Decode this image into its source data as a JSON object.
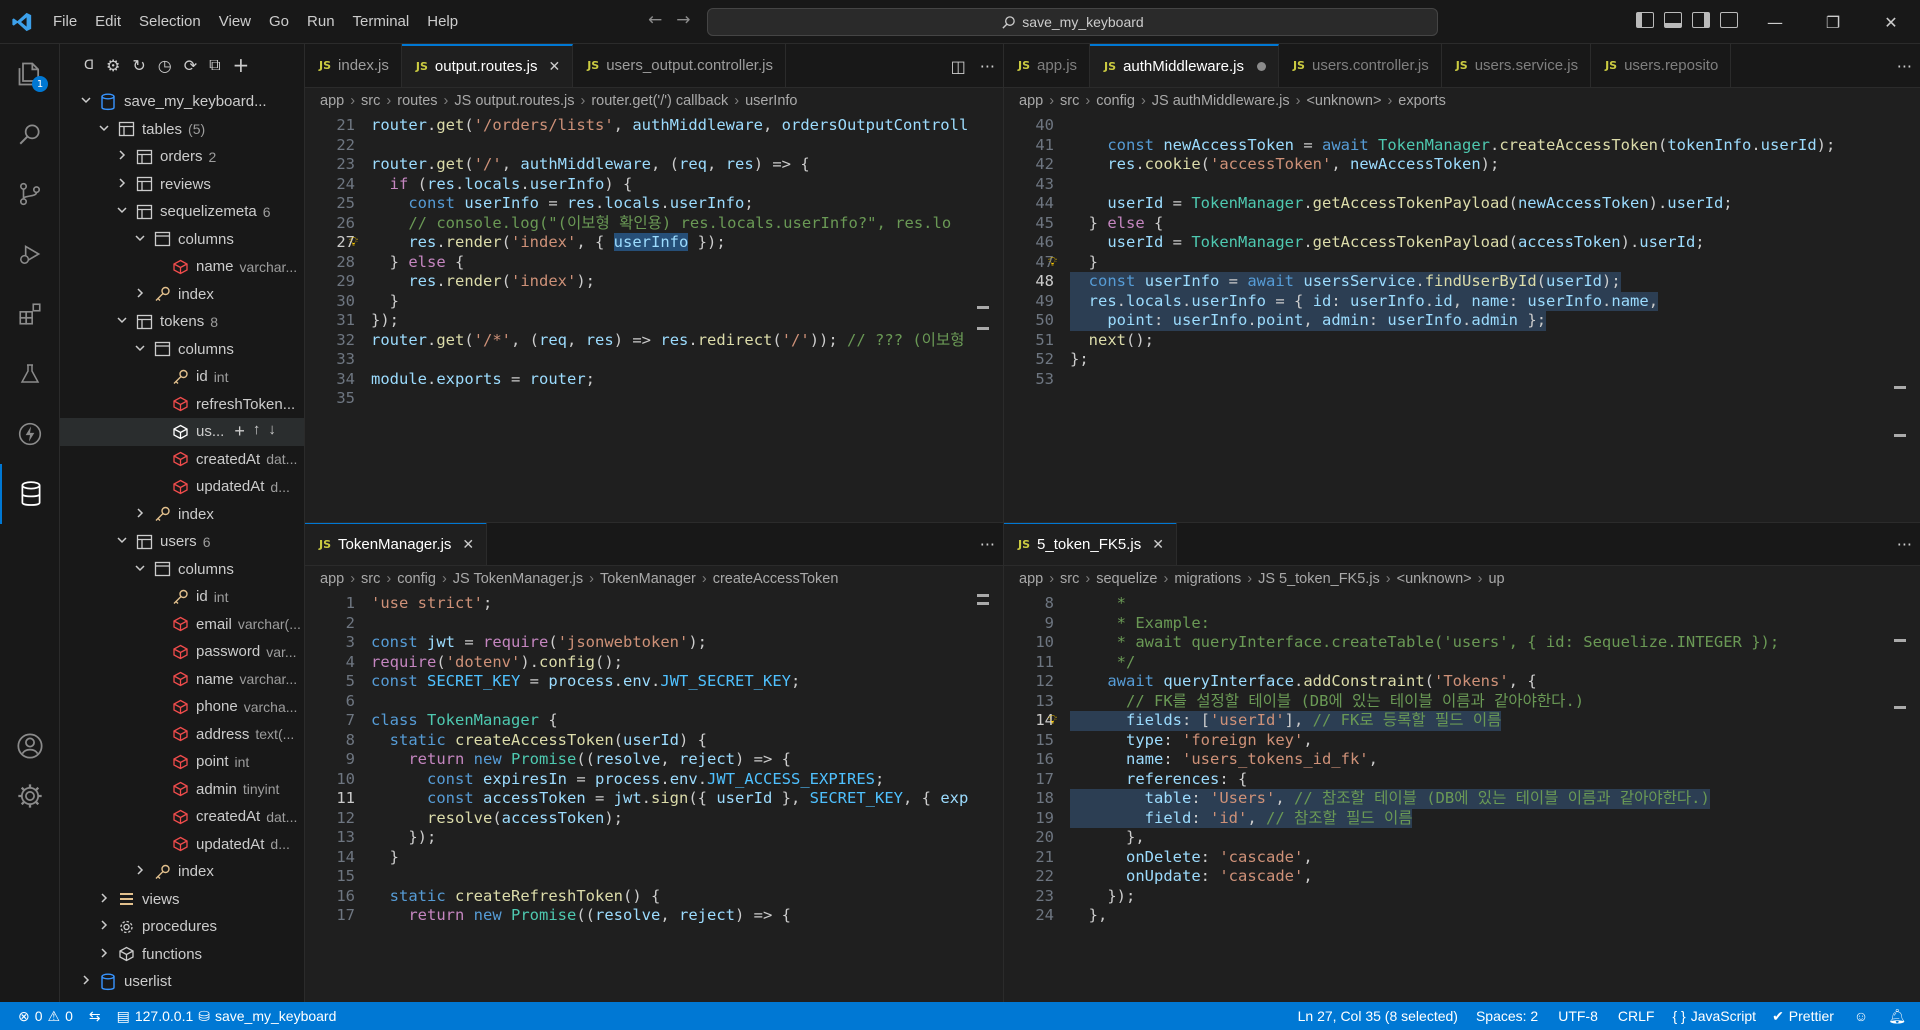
{
  "menu": [
    "File",
    "Edit",
    "Selection",
    "View",
    "Go",
    "Run",
    "Terminal",
    "Help"
  ],
  "search": {
    "text": "save_my_keyboard"
  },
  "activity": {
    "badge": "1"
  },
  "tree": [
    {
      "d": 0,
      "tw": "v",
      "icon": "db",
      "label": "save_my_keyboard...",
      "sub": ""
    },
    {
      "d": 1,
      "tw": "v",
      "icon": "table",
      "label": "tables",
      "sub": "(5)"
    },
    {
      "d": 2,
      "tw": ">",
      "icon": "table",
      "label": "orders",
      "sub": "2"
    },
    {
      "d": 2,
      "tw": ">",
      "icon": "table",
      "label": "reviews",
      "sub": ""
    },
    {
      "d": 2,
      "tw": "v",
      "icon": "table",
      "label": "sequelizemeta",
      "sub": "6"
    },
    {
      "d": 3,
      "tw": "v",
      "icon": "columns",
      "label": "columns",
      "sub": ""
    },
    {
      "d": 4,
      "tw": "",
      "icon": "col",
      "label": "name",
      "sub": "varchar..."
    },
    {
      "d": 3,
      "tw": ">",
      "icon": "key",
      "label": "index",
      "sub": ""
    },
    {
      "d": 2,
      "tw": "v",
      "icon": "table",
      "label": "tokens",
      "sub": "8"
    },
    {
      "d": 3,
      "tw": "v",
      "icon": "columns",
      "label": "columns",
      "sub": ""
    },
    {
      "d": 4,
      "tw": "",
      "icon": "key",
      "label": "id",
      "sub": "int"
    },
    {
      "d": 4,
      "tw": "",
      "icon": "col",
      "label": "refreshToken...",
      "sub": ""
    },
    {
      "d": 4,
      "tw": "",
      "icon": "cube",
      "label": "us...",
      "sub": "",
      "selected": true
    },
    {
      "d": 4,
      "tw": "",
      "icon": "col",
      "label": "createdAt",
      "sub": "dat..."
    },
    {
      "d": 4,
      "tw": "",
      "icon": "col",
      "label": "updatedAt",
      "sub": "d..."
    },
    {
      "d": 3,
      "tw": ">",
      "icon": "key",
      "label": "index",
      "sub": ""
    },
    {
      "d": 2,
      "tw": "v",
      "icon": "table",
      "label": "users",
      "sub": "6"
    },
    {
      "d": 3,
      "tw": "v",
      "icon": "columns",
      "label": "columns",
      "sub": ""
    },
    {
      "d": 4,
      "tw": "",
      "icon": "key",
      "label": "id",
      "sub": "int"
    },
    {
      "d": 4,
      "tw": "",
      "icon": "col",
      "label": "email",
      "sub": "varchar(..."
    },
    {
      "d": 4,
      "tw": "",
      "icon": "col",
      "label": "password",
      "sub": "var..."
    },
    {
      "d": 4,
      "tw": "",
      "icon": "col",
      "label": "name",
      "sub": "varchar..."
    },
    {
      "d": 4,
      "tw": "",
      "icon": "col",
      "label": "phone",
      "sub": "varcha..."
    },
    {
      "d": 4,
      "tw": "",
      "icon": "col",
      "label": "address",
      "sub": "text(..."
    },
    {
      "d": 4,
      "tw": "",
      "icon": "col",
      "label": "point",
      "sub": "int"
    },
    {
      "d": 4,
      "tw": "",
      "icon": "col",
      "label": "admin",
      "sub": "tinyint"
    },
    {
      "d": 4,
      "tw": "",
      "icon": "col",
      "label": "createdAt",
      "sub": "dat..."
    },
    {
      "d": 4,
      "tw": "",
      "icon": "col",
      "label": "updatedAt",
      "sub": "d..."
    },
    {
      "d": 3,
      "tw": ">",
      "icon": "key",
      "label": "index",
      "sub": ""
    },
    {
      "d": 1,
      "tw": ">",
      "icon": "views",
      "label": "views",
      "sub": ""
    },
    {
      "d": 1,
      "tw": ">",
      "icon": "gear",
      "label": "procedures",
      "sub": ""
    },
    {
      "d": 1,
      "tw": ">",
      "icon": "fn",
      "label": "functions",
      "sub": ""
    },
    {
      "d": 0,
      "tw": ">",
      "icon": "db",
      "label": "userlist",
      "sub": ""
    }
  ],
  "groups": [
    {
      "tabs": [
        {
          "label": "index.js",
          "active": false,
          "close": false,
          "dim": false,
          "dirty": false
        },
        {
          "label": "output.routes.js",
          "active": true,
          "close": true,
          "dim": false,
          "dirty": false
        },
        {
          "label": "users_output.controller.js",
          "active": false,
          "close": false,
          "dim": false,
          "dirty": false
        }
      ],
      "crumbs": [
        "app",
        "src",
        "routes",
        "JS output.routes.js",
        "router.get('/') callback",
        "userInfo"
      ],
      "lines": [
        {
          "n": "21",
          "t": "router.get('/orders/lists', authMiddleware, ordersOutputControll"
        },
        {
          "n": "22",
          "t": ""
        },
        {
          "n": "23",
          "t": "router.get('/', authMiddleware, (req, res) => {"
        },
        {
          "n": "24",
          "t": "  if (res.locals.userInfo) {"
        },
        {
          "n": "25",
          "t": "    const userInfo = res.locals.userInfo;"
        },
        {
          "n": "26",
          "t": "    // console.log(\"(이보형 확인용) res.locals.userInfo?\", res.lo"
        },
        {
          "n": "27",
          "t": "    res.render('index', { userInfo });",
          "bulb": true,
          "cur": true
        },
        {
          "n": "28",
          "t": "  } else {"
        },
        {
          "n": "29",
          "t": "    res.render('index');"
        },
        {
          "n": "30",
          "t": "  }"
        },
        {
          "n": "31",
          "t": "});"
        },
        {
          "n": "32",
          "t": "router.get('/*', (req, res) => res.redirect('/')); // ??? (이보형"
        },
        {
          "n": "33",
          "t": ""
        },
        {
          "n": "34",
          "t": "module.exports = router;"
        },
        {
          "n": "35",
          "t": ""
        }
      ]
    },
    {
      "tabs": [
        {
          "label": "app.js",
          "active": false,
          "close": false,
          "dim": true,
          "dirty": false
        },
        {
          "label": "authMiddleware.js",
          "active": true,
          "close": false,
          "dim": false,
          "dirty": true
        },
        {
          "label": "users.controller.js",
          "active": false,
          "close": false,
          "dim": true,
          "dirty": false
        },
        {
          "label": "users.service.js",
          "active": false,
          "close": false,
          "dim": true,
          "dirty": false
        },
        {
          "label": "users.reposito",
          "active": false,
          "close": false,
          "dim": true,
          "dirty": false
        }
      ],
      "crumbs": [
        "app",
        "src",
        "config",
        "JS authMiddleware.js",
        "<unknown>",
        "exports"
      ],
      "lines": [
        {
          "n": "40",
          "t": ""
        },
        {
          "n": "41",
          "t": "    const newAccessToken = await TokenManager.createAccessToken(tokenInfo.userId);"
        },
        {
          "n": "42",
          "t": "    res.cookie('accessToken', newAccessToken);"
        },
        {
          "n": "43",
          "t": ""
        },
        {
          "n": "44",
          "t": "    userId = TokenManager.getAccessTokenPayload(newAccessToken).userId;"
        },
        {
          "n": "45",
          "t": "  } else {"
        },
        {
          "n": "46",
          "t": "    userId = TokenManager.getAccessTokenPayload(accessToken).userId;"
        },
        {
          "n": "47",
          "t": "  }",
          "bulb": true
        },
        {
          "n": "48",
          "t": "  const userInfo = await usersService.findUserById(userId);",
          "cur": true
        },
        {
          "n": "49",
          "t": "  res.locals.userInfo = { id: userInfo.id, name: userInfo.name,"
        },
        {
          "n": "50",
          "t": "    point: userInfo.point, admin: userInfo.admin };"
        },
        {
          "n": "51",
          "t": "  next();"
        },
        {
          "n": "52",
          "t": "};"
        },
        {
          "n": "53",
          "t": ""
        }
      ]
    },
    {
      "tabs": [
        {
          "label": "TokenManager.js",
          "active": true,
          "close": true,
          "dim": false,
          "dirty": false
        }
      ],
      "crumbs": [
        "app",
        "src",
        "config",
        "JS TokenManager.js",
        "TokenManager",
        "createAccessToken"
      ],
      "lines": [
        {
          "n": "1",
          "t": "'use strict';"
        },
        {
          "n": "2",
          "t": ""
        },
        {
          "n": "3",
          "t": "const jwt = require('jsonwebtoken');"
        },
        {
          "n": "4",
          "t": "require('dotenv').config();"
        },
        {
          "n": "5",
          "t": "const SECRET_KEY = process.env.JWT_SECRET_KEY;"
        },
        {
          "n": "6",
          "t": ""
        },
        {
          "n": "7",
          "t": "class TokenManager {"
        },
        {
          "n": "8",
          "t": "  static createAccessToken(userId) {"
        },
        {
          "n": "9",
          "t": "    return new Promise((resolve, reject) => {"
        },
        {
          "n": "10",
          "t": "      const expiresIn = process.env.JWT_ACCESS_EXPIRES;"
        },
        {
          "n": "11",
          "t": "      const accessToken = jwt.sign({ userId }, SECRET_KEY, { exp",
          "cur": true
        },
        {
          "n": "12",
          "t": "      resolve(accessToken);"
        },
        {
          "n": "13",
          "t": "    });"
        },
        {
          "n": "14",
          "t": "  }"
        },
        {
          "n": "15",
          "t": ""
        },
        {
          "n": "16",
          "t": "  static createRefreshToken() {"
        },
        {
          "n": "17",
          "t": "    return new Promise((resolve, reject) => {"
        }
      ]
    },
    {
      "tabs": [
        {
          "label": "5_token_FK5.js",
          "active": true,
          "close": true,
          "dim": false,
          "dirty": false
        }
      ],
      "crumbs": [
        "app",
        "src",
        "sequelize",
        "migrations",
        "JS 5_token_FK5.js",
        "<unknown>",
        "up"
      ],
      "lines": [
        {
          "n": "8",
          "t": "     *"
        },
        {
          "n": "9",
          "t": "     * Example:"
        },
        {
          "n": "10",
          "t": "     * await queryInterface.createTable('users', { id: Sequelize.INTEGER });"
        },
        {
          "n": "11",
          "t": "     */"
        },
        {
          "n": "12",
          "t": "    await queryInterface.addConstraint('Tokens', {"
        },
        {
          "n": "13",
          "t": "      // FK를 설정할 테이블 (DB에 있는 테이블 이름과 같아야한다.)"
        },
        {
          "n": "14",
          "t": "      fields: ['userId'], // FK로 등록할 필드 이름",
          "bulb": true,
          "cur": true
        },
        {
          "n": "15",
          "t": "      type: 'foreign key',"
        },
        {
          "n": "16",
          "t": "      name: 'users_tokens_id_fk',"
        },
        {
          "n": "17",
          "t": "      references: {"
        },
        {
          "n": "18",
          "t": "        table: 'Users', // 참조할 테이블 (DB에 있는 테이블 이름과 같아야한다.)"
        },
        {
          "n": "19",
          "t": "        field: 'id', // 참조할 필드 이름"
        },
        {
          "n": "20",
          "t": "      },"
        },
        {
          "n": "21",
          "t": "      onDelete: 'cascade',"
        },
        {
          "n": "22",
          "t": "      onUpdate: 'cascade',"
        },
        {
          "n": "23",
          "t": "    });"
        },
        {
          "n": "24",
          "t": "  },"
        }
      ]
    }
  ],
  "status": {
    "errors": "0",
    "warnings": "0",
    "connection": "127.0.0.1",
    "database": "save_my_keyboard",
    "position": "Ln 27, Col 35 (8 selected)",
    "spaces": "Spaces: 2",
    "encoding": "UTF-8",
    "eol": "CRLF",
    "language": "JavaScript",
    "formatter": "Prettier"
  },
  "colors": {
    "accent": "#0078d4",
    "keyword": "#569cd6",
    "control": "#c586c0",
    "string": "#ce9178",
    "func": "#dcdcaa",
    "var": "#9cdcfe",
    "comment": "#6a9955",
    "cls": "#4ec9b0",
    "const": "#4fc1ff",
    "num": "#b5cea8"
  }
}
